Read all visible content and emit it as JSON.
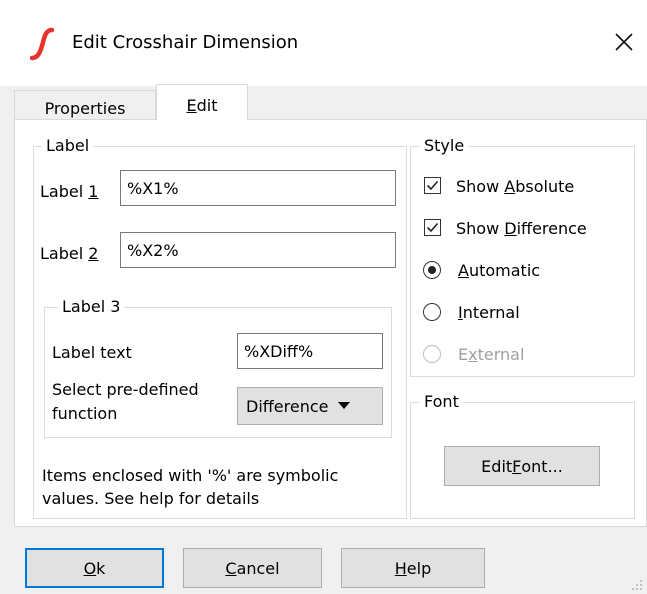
{
  "window": {
    "title": "Edit Crosshair Dimension",
    "icon": "ltspice-app-icon",
    "close_icon": "close-icon"
  },
  "tabs": [
    {
      "label": "Properties",
      "underline": "",
      "selected": false
    },
    {
      "label_pre": "",
      "label_ul": "E",
      "label_post": "dit",
      "selected": true
    }
  ],
  "label_group": {
    "title": "Label",
    "label1": {
      "pre": "Label ",
      "ul": "1",
      "value": "%X1%"
    },
    "label2": {
      "pre": "Label ",
      "ul": "2",
      "value": "%X2%"
    },
    "label3": {
      "title": "Label 3",
      "text_label": "Label text",
      "text_value": "%XDiff%",
      "select_label_line1": "Select pre-defined",
      "select_label_line2": "function",
      "select_value": "Difference"
    },
    "note_line1": "Items enclosed with '%' are symbolic",
    "note_line2": "values. See help for details"
  },
  "style_group": {
    "title": "Style",
    "show_absolute": {
      "pre": "Show ",
      "ul": "A",
      "post": "bsolute",
      "checked": true
    },
    "show_difference": {
      "pre": "Show ",
      "ul": "D",
      "post": "ifference",
      "checked": true
    },
    "automatic": {
      "pre": "",
      "ul": "A",
      "post": "utomatic",
      "selected": true
    },
    "internal": {
      "pre": "",
      "ul": "I",
      "post": "nternal",
      "selected": false
    },
    "external": {
      "pre": "E",
      "ul": "x",
      "post": "ternal",
      "selected": false,
      "disabled": true
    }
  },
  "font_group": {
    "title": "Font",
    "edit_font": {
      "pre": "Edit ",
      "ul": "F",
      "post": "ont..."
    }
  },
  "buttons": {
    "ok": {
      "pre": "",
      "ul": "O",
      "post": "k"
    },
    "cancel": {
      "pre": "",
      "ul": "C",
      "post": "ancel"
    },
    "help": {
      "pre": "",
      "ul": "H",
      "post": "elp"
    }
  },
  "colors": {
    "accent": "#0078d7",
    "app_icon": "#e8322b"
  }
}
